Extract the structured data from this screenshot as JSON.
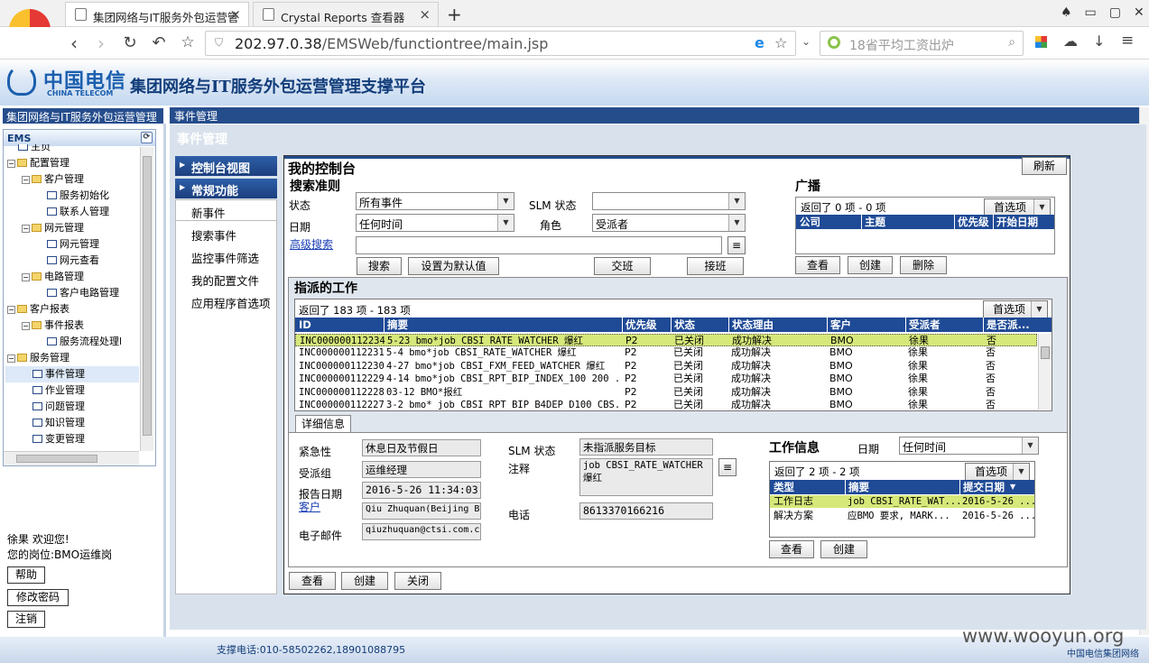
{
  "browser": {
    "tabs": [
      {
        "label": "集团网络与IT服务外包运营管"
      },
      {
        "label": "Crystal Reports 查看器"
      }
    ],
    "new_tab": "+",
    "url_host": "202.97.0.38",
    "url_path": "/EMSWeb/functiontree/main.jsp",
    "search_placeholder": "18省平均工资出炉"
  },
  "banner": {
    "logo_cn": "中国电信",
    "logo_en": "CHINA TELECOM",
    "title": "集团网络与IT服务外包运营管理支撑平台"
  },
  "sidebar": {
    "header": "集团网络与IT服务外包运营管理",
    "ems": "EMS",
    "tree": [
      {
        "label": "主页",
        "lvl": 1,
        "kind": "doc"
      },
      {
        "label": "配置管理",
        "lvl": 1,
        "kind": "fold"
      },
      {
        "label": "客户管理",
        "lvl": 2,
        "kind": "fold"
      },
      {
        "label": "服务初始化",
        "lvl": 3,
        "kind": "doc"
      },
      {
        "label": "联系人管理",
        "lvl": 3,
        "kind": "doc"
      },
      {
        "label": "网元管理",
        "lvl": 2,
        "kind": "fold"
      },
      {
        "label": "网元管理",
        "lvl": 3,
        "kind": "doc"
      },
      {
        "label": "网元查看",
        "lvl": 3,
        "kind": "doc"
      },
      {
        "label": "电路管理",
        "lvl": 2,
        "kind": "fold"
      },
      {
        "label": "客户电路管理",
        "lvl": 3,
        "kind": "doc"
      },
      {
        "label": "客户报表",
        "lvl": 1,
        "kind": "fold"
      },
      {
        "label": "事件报表",
        "lvl": 2,
        "kind": "fold"
      },
      {
        "label": "服务流程处理l",
        "lvl": 3,
        "kind": "doc"
      },
      {
        "label": "服务管理",
        "lvl": 1,
        "kind": "fold"
      },
      {
        "label": "事件管理",
        "lvl": 2,
        "kind": "doc",
        "selected": true
      },
      {
        "label": "作业管理",
        "lvl": 2,
        "kind": "doc"
      },
      {
        "label": "问题管理",
        "lvl": 2,
        "kind": "doc"
      },
      {
        "label": "知识管理",
        "lvl": 2,
        "kind": "doc"
      },
      {
        "label": "变更管理",
        "lvl": 2,
        "kind": "doc"
      }
    ],
    "user_line1": "徐果  欢迎您!",
    "user_line2": "您的岗位:BMO运维岗",
    "help": "帮助",
    "change_pw": "修改密码",
    "logout": "注销"
  },
  "main": {
    "header": "事件管理",
    "page_title": "事件管理"
  },
  "lnav": {
    "console_view": "控制台视图",
    "common": "常规功能",
    "items": [
      "新事件",
      "搜索事件",
      "监控事件筛选",
      "我的配置文件",
      "应用程序首选项"
    ]
  },
  "console": {
    "title": "我的控制台",
    "refresh": "刷新",
    "search_criteria": "搜索准则",
    "state_label": "状态",
    "state_value": "所有事件",
    "slm_label": "SLM 状态",
    "slm_value": "",
    "date_label": "日期",
    "date_value": "任何时间",
    "role_label": "角色",
    "role_value": "受派者",
    "adv_search": "高级搜索",
    "btn_search": "搜索",
    "btn_default": "设置为默认值",
    "btn_handover": "交班",
    "btn_takeover": "接班",
    "broadcast": "广播",
    "bc_count": "返回了 0 项 - 0 项",
    "bc_pref": "首选项",
    "bc_cols": [
      "公司",
      "主题",
      "优先级",
      "开始日期"
    ],
    "bc_view": "查看",
    "bc_create": "创建",
    "bc_delete": "删除"
  },
  "work": {
    "title": "指派的工作",
    "count": "返回了 183 项 - 183 项",
    "pref": "首选项",
    "cols": [
      "ID",
      "摘要",
      "优先级",
      "状态",
      "状态理由",
      "客户",
      "受派者",
      "是否派..."
    ],
    "rows": [
      [
        "INC000000112234",
        "5-23 bmo*job CBSI_RATE_WATCHER 爆红",
        "P2",
        "已关闭",
        "成功解决",
        "BMO",
        "徐果",
        "否"
      ],
      [
        "INC000000112231",
        "5-4 bmo*job CBSI_RATE_WATCHER 爆红",
        "P2",
        "已关闭",
        "成功解决",
        "BMO",
        "徐果",
        "否"
      ],
      [
        "INC000000112230",
        "4-27 bmo*job CBSI_FXM_FEED_WATCHER 爆红",
        "P2",
        "已关闭",
        "成功解决",
        "BMO",
        "徐果",
        "否"
      ],
      [
        "INC000000112229",
        "4-14 bmo*job CBSI_RPT_BIP_INDEX_100 200 ...",
        "P2",
        "已关闭",
        "成功解决",
        "BMO",
        "徐果",
        "否"
      ],
      [
        "INC000000112228",
        "03-12 BMO*报红",
        "P2",
        "已关闭",
        "成功解决",
        "BMO",
        "徐果",
        "否"
      ],
      [
        "INC000000112227",
        "3-2 bmo* job CBSI_RPT_BIP_B4DEP_D100 CBS...",
        "P2",
        "已关闭",
        "成功解决",
        "BMO",
        "徐果",
        "否"
      ]
    ]
  },
  "detail": {
    "tab": "详细信息",
    "urgency_label": "紧急性",
    "urgency_value": "休息日及节假日",
    "group_label": "受派组",
    "group_value": "运维经理",
    "report_date_label": "报告日期",
    "report_date_value": "2016-5-26 11:34:03",
    "customer_label": "客户",
    "customer_value": "Qiu Zhuquan(Beijing BV",
    "email_label": "电子邮件",
    "email_value": "qiuzhuquan@ctsi.com.cn",
    "slm_label": "SLM 状态",
    "slm_value": "未指派服务目标",
    "note_label": "注释",
    "note_value_1": "job CBSI_RATE_WATCHER",
    "note_value_2": "爆红",
    "phone_label": "电话",
    "phone_value": "8613370166216",
    "workinfo_title": "工作信息",
    "wi_date_label": "日期",
    "wi_date_value": "任何时间",
    "wi_count": "返回了 2 项 - 2 项",
    "wi_pref": "首选项",
    "wi_cols": [
      "类型",
      "摘要",
      "提交日期"
    ],
    "wi_rows": [
      [
        "工作日志",
        "job CBSI_RATE_WAT...",
        "2016-5-26 ..."
      ],
      [
        "解决方案",
        "应BMO 要求, MARK...",
        "2016-5-26 ..."
      ]
    ],
    "wi_view": "查看",
    "wi_create": "创建"
  },
  "bottom": {
    "view": "查看",
    "create": "创建",
    "close": "关闭"
  },
  "footer": {
    "support": "支撑电话:010-58502262,18901088795",
    "watermark": "www.wooyun.org",
    "corp": "中国电信集团网络"
  },
  "colors": {
    "nav_blue": "#254d8c",
    "table_head": "#1f4a96",
    "row_highlight": "#d6e87a"
  }
}
